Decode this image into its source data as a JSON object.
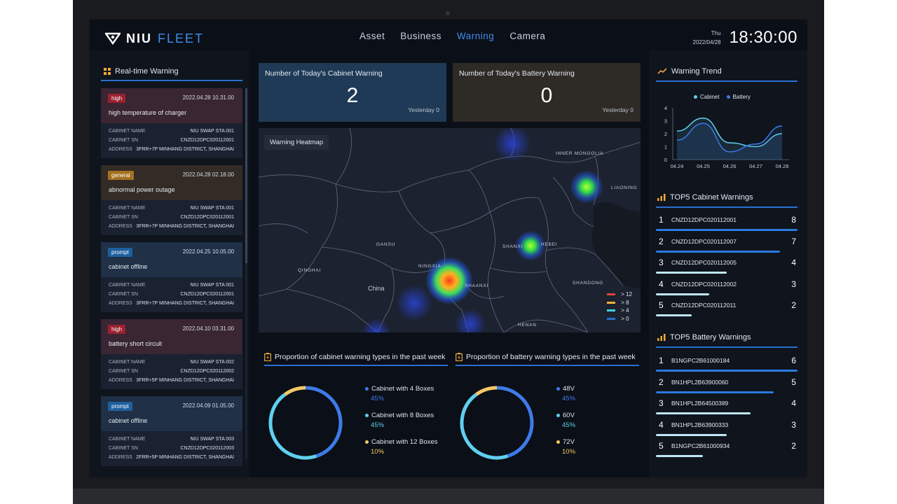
{
  "brand": {
    "niu": "NIU",
    "fleet": "FLEET"
  },
  "nav": [
    "Asset",
    "Business",
    "Warning",
    "Camera"
  ],
  "nav_active": "Warning",
  "clock": {
    "weekday": "Thu",
    "date": "2022/04/28",
    "time": "18:30:00"
  },
  "realtime": {
    "title": "Real-time Warning",
    "field_labels": {
      "name": "CABINET NAME",
      "sn": "CABINET SN",
      "address": "ADDRESS"
    },
    "items": [
      {
        "level": "high",
        "date": "2022.04.28 10.31.00",
        "title": "high temperature of charger",
        "name": "NIU SWAP STA 001",
        "sn": "CNZD12DPC020112001",
        "address": "3FRR+7P MINHANG DISTRICT, SHANGHAI"
      },
      {
        "level": "general",
        "date": "2022.04.28 02.18.00",
        "title": "abnormal power outage",
        "name": "NIU SWAP STA 001",
        "sn": "CNZD12DPC020112001",
        "address": "3FRR+7P MINHANG DISTRICT, SHANGHAI"
      },
      {
        "level": "prompt",
        "date": "2022.04.25 10.05.00",
        "title": "cabinet offline",
        "name": "NIU SWAP STA 001",
        "sn": "CNZD12DPC020112001",
        "address": "3FRR+7P MINHANG DISTRICT, SHANGHAI"
      },
      {
        "level": "high",
        "date": "2022.04.10 03.31.00",
        "title": "battery short circuit",
        "name": "NIU SWAP STA 002",
        "sn": "CNZD12DPC020112002",
        "address": "3FRR+5P MINHANG DISTRICT, SHANGHAI"
      },
      {
        "level": "prompt",
        "date": "2022.04.09 01.05.00",
        "title": "cabinet offline",
        "name": "NIU SWAP STA 003",
        "sn": "CNZD12DPC020112003",
        "address": "2FRR+5P MINHANG DISTRICT, SHANGHAI"
      }
    ]
  },
  "stats": {
    "cabinet": {
      "label": "Number of Today's Cabinet Warning",
      "value": "2",
      "yesterday": "Yesterday 0"
    },
    "battery": {
      "label": "Number of Today's Battery Warning",
      "value": "0",
      "yesterday": "Yesterday 0"
    }
  },
  "map": {
    "title": "Warning Heatmap",
    "regions": [
      "INNER MONGOLIA",
      "LIAONING",
      "GANSU",
      "SHANXI",
      "HEBEI",
      "NINGXIA",
      "QINGHAI",
      "SHAANXI",
      "China",
      "SHANDONG",
      "HENAN"
    ],
    "legend": [
      {
        "label": "> 12",
        "color": "#e8413b"
      },
      {
        "label": "> 8",
        "color": "#f0b13b"
      },
      {
        "label": "> 4",
        "color": "#3fd0e0"
      },
      {
        "label": "> 0",
        "color": "#2a6fd0"
      }
    ]
  },
  "cabinet_types": {
    "title": "Proportion of cabinet warning types in the past week",
    "items": [
      {
        "label": "Cabinet with 4 Boxes",
        "pct": "45%",
        "value": 45,
        "color": "#3d7be8"
      },
      {
        "label": "Cabinet with 8 Boxes",
        "pct": "45%",
        "value": 45,
        "color": "#5fd0f0"
      },
      {
        "label": "Cabinet with 12 Boxes",
        "pct": "10%",
        "value": 10,
        "color": "#f5c867"
      }
    ]
  },
  "battery_types": {
    "title": "Proportion of battery warning types in the past week",
    "items": [
      {
        "label": "48V",
        "pct": "45%",
        "value": 45,
        "color": "#3d7be8"
      },
      {
        "label": "60V",
        "pct": "45%",
        "value": 45,
        "color": "#5fd0f0"
      },
      {
        "label": "72V",
        "pct": "10%",
        "value": 10,
        "color": "#f5c867"
      }
    ]
  },
  "trend": {
    "title": "Warning Trend",
    "chart_data": {
      "type": "line",
      "categories": [
        "04.24",
        "04.25",
        "04.26",
        "04.27",
        "04.28"
      ],
      "ylim": [
        0,
        4
      ],
      "yticks": [
        "0",
        "1",
        "2",
        "3",
        "4"
      ],
      "series": [
        {
          "name": "Cabinet",
          "values": [
            2.2,
            3.2,
            1.3,
            1.0,
            2.0
          ],
          "color": "#5fd0f0"
        },
        {
          "name": "Battery",
          "values": [
            1.5,
            2.8,
            0.6,
            1.2,
            2.6
          ],
          "color": "#3d7be8"
        }
      ],
      "grid": false,
      "legend": "top"
    }
  },
  "top5_cabinet": {
    "title": "TOP5 Cabinet Warnings",
    "rows": [
      {
        "rank": "1",
        "name": "CNZD12DPC020112001",
        "count": "8",
        "value": 8
      },
      {
        "rank": "2",
        "name": "CNZD12DPC020112007",
        "count": "7",
        "value": 7
      },
      {
        "rank": "3",
        "name": "CNZD12DPC020112005",
        "count": "4",
        "value": 4
      },
      {
        "rank": "4",
        "name": "CNZD12DPC020112002",
        "count": "3",
        "value": 3
      },
      {
        "rank": "5",
        "name": "CNZD12DPC020112011",
        "count": "2",
        "value": 2
      }
    ]
  },
  "top5_battery": {
    "title": "TOP5 Battery Warnings",
    "rows": [
      {
        "rank": "1",
        "name": "B1NGPC2B61000184",
        "count": "6",
        "value": 6
      },
      {
        "rank": "2",
        "name": "BN1HPL2B63900060",
        "count": "5",
        "value": 5
      },
      {
        "rank": "3",
        "name": "BN1HPL2B64500389",
        "count": "4",
        "value": 4
      },
      {
        "rank": "4",
        "name": "BN1HPL2B63900333",
        "count": "3",
        "value": 3
      },
      {
        "rank": "5",
        "name": "B1NGPC2B61000934",
        "count": "2",
        "value": 2
      }
    ]
  }
}
